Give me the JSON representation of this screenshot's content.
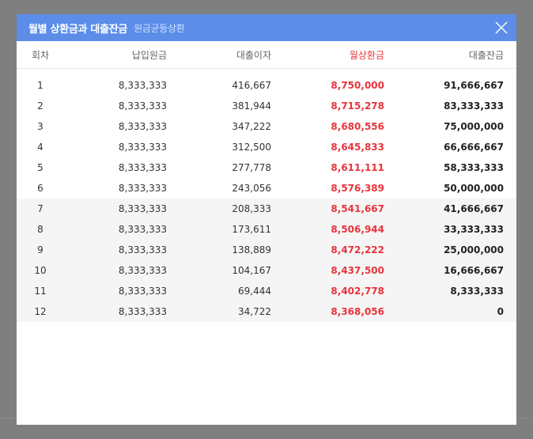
{
  "modal": {
    "title": "월별 상환금과 대출잔금",
    "subtitle": "원금균등상환"
  },
  "columns": {
    "round": "회차",
    "principal": "납입원금",
    "interest": "대출이자",
    "monthly": "월상환금",
    "balance": "대출잔금"
  },
  "rows": [
    {
      "round": "1",
      "principal": "8,333,333",
      "interest": "416,667",
      "monthly": "8,750,000",
      "balance": "91,666,667"
    },
    {
      "round": "2",
      "principal": "8,333,333",
      "interest": "381,944",
      "monthly": "8,715,278",
      "balance": "83,333,333"
    },
    {
      "round": "3",
      "principal": "8,333,333",
      "interest": "347,222",
      "monthly": "8,680,556",
      "balance": "75,000,000"
    },
    {
      "round": "4",
      "principal": "8,333,333",
      "interest": "312,500",
      "monthly": "8,645,833",
      "balance": "66,666,667"
    },
    {
      "round": "5",
      "principal": "8,333,333",
      "interest": "277,778",
      "monthly": "8,611,111",
      "balance": "58,333,333"
    },
    {
      "round": "6",
      "principal": "8,333,333",
      "interest": "243,056",
      "monthly": "8,576,389",
      "balance": "50,000,000"
    },
    {
      "round": "7",
      "principal": "8,333,333",
      "interest": "208,333",
      "monthly": "8,541,667",
      "balance": "41,666,667"
    },
    {
      "round": "8",
      "principal": "8,333,333",
      "interest": "173,611",
      "monthly": "8,506,944",
      "balance": "33,333,333"
    },
    {
      "round": "9",
      "principal": "8,333,333",
      "interest": "138,889",
      "monthly": "8,472,222",
      "balance": "25,000,000"
    },
    {
      "round": "10",
      "principal": "8,333,333",
      "interest": "104,167",
      "monthly": "8,437,500",
      "balance": "16,666,667"
    },
    {
      "round": "11",
      "principal": "8,333,333",
      "interest": "69,444",
      "monthly": "8,402,778",
      "balance": "8,333,333"
    },
    {
      "round": "12",
      "principal": "8,333,333",
      "interest": "34,722",
      "monthly": "8,368,056",
      "balance": "0"
    }
  ],
  "colors": {
    "header_bg": "#5b8de9",
    "accent_red": "#e8343c",
    "overlay": "#7f7f7f"
  },
  "icons": {
    "close": "close-icon"
  }
}
